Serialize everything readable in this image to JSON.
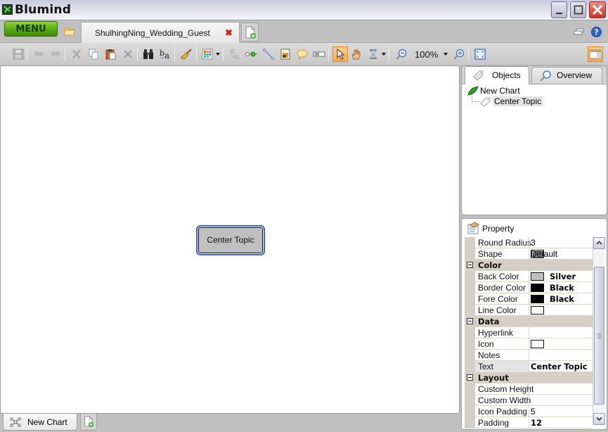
{
  "window": {
    "title": "Blumind",
    "controls": [
      "minimize",
      "maximize",
      "close"
    ]
  },
  "menubar": {
    "menu_label": "MENU",
    "document_tab": {
      "label": "ShulhingNing_Wedding_Guest",
      "close_glyph": "✖"
    },
    "right_icons": [
      "cloud-icon",
      "help-icon"
    ]
  },
  "toolbar": {
    "items": [
      "save",
      "undo",
      "redo",
      "cut",
      "copy",
      "paste",
      "delete",
      "find",
      "replace",
      "format-painter",
      "color-theme",
      "add-subtopic",
      "add-link",
      "draw-line",
      "add-image",
      "add-note-callout",
      "add-progress",
      "select-tool",
      "hand-tool",
      "timer",
      "zoom-out",
      "zoom-level",
      "zoom-in",
      "fit-to-window",
      "toggle-sidebar"
    ],
    "zoom_level": "100%",
    "active_tool": "select-tool"
  },
  "canvas": {
    "topic": {
      "label": "Center Topic",
      "back_color": "#C0C0C0",
      "border_color": "#000000",
      "selection_color": "#3B63D8"
    }
  },
  "bottom_tabs": {
    "chart_tab_label": "New Chart"
  },
  "objects_panel": {
    "tabs": [
      {
        "label": "Objects",
        "active": true
      },
      {
        "label": "Overview",
        "active": false
      }
    ],
    "tree": {
      "root": "New Chart",
      "children": [
        "Center Topic"
      ]
    }
  },
  "property_panel": {
    "title": "Property",
    "rows": [
      {
        "type": "prop",
        "key": "Round Radius",
        "value": "3"
      },
      {
        "type": "prop",
        "key": "Shape",
        "value": "Default",
        "swatch": "shape"
      },
      {
        "type": "category",
        "key": "Color"
      },
      {
        "type": "prop",
        "key": "Back Color",
        "value": "Silver",
        "bold": true,
        "swatch": "#C0C0C0"
      },
      {
        "type": "prop",
        "key": "Border Color",
        "value": "Black",
        "bold": true,
        "swatch": "#000000"
      },
      {
        "type": "prop",
        "key": "Fore Color",
        "value": "Black",
        "bold": true,
        "swatch": "#000000"
      },
      {
        "type": "prop",
        "key": "Line Color",
        "value": "",
        "swatch": "#FFFFFF"
      },
      {
        "type": "category",
        "key": "Data"
      },
      {
        "type": "prop",
        "key": "Hyperlink",
        "value": ""
      },
      {
        "type": "prop",
        "key": "Icon",
        "value": "",
        "swatch": "#FFFFFF"
      },
      {
        "type": "prop",
        "key": "Notes",
        "value": ""
      },
      {
        "type": "prop",
        "key": "Text",
        "value": "Center Topic",
        "bold": true,
        "key_highlight": true
      },
      {
        "type": "category",
        "key": "Layout"
      },
      {
        "type": "prop",
        "key": "Custom Height",
        "value": ""
      },
      {
        "type": "prop",
        "key": "Custom Width",
        "value": ""
      },
      {
        "type": "prop",
        "key": "Icon Padding",
        "value": "5"
      },
      {
        "type": "prop",
        "key": "Padding",
        "value": "12",
        "bold": true
      }
    ]
  }
}
